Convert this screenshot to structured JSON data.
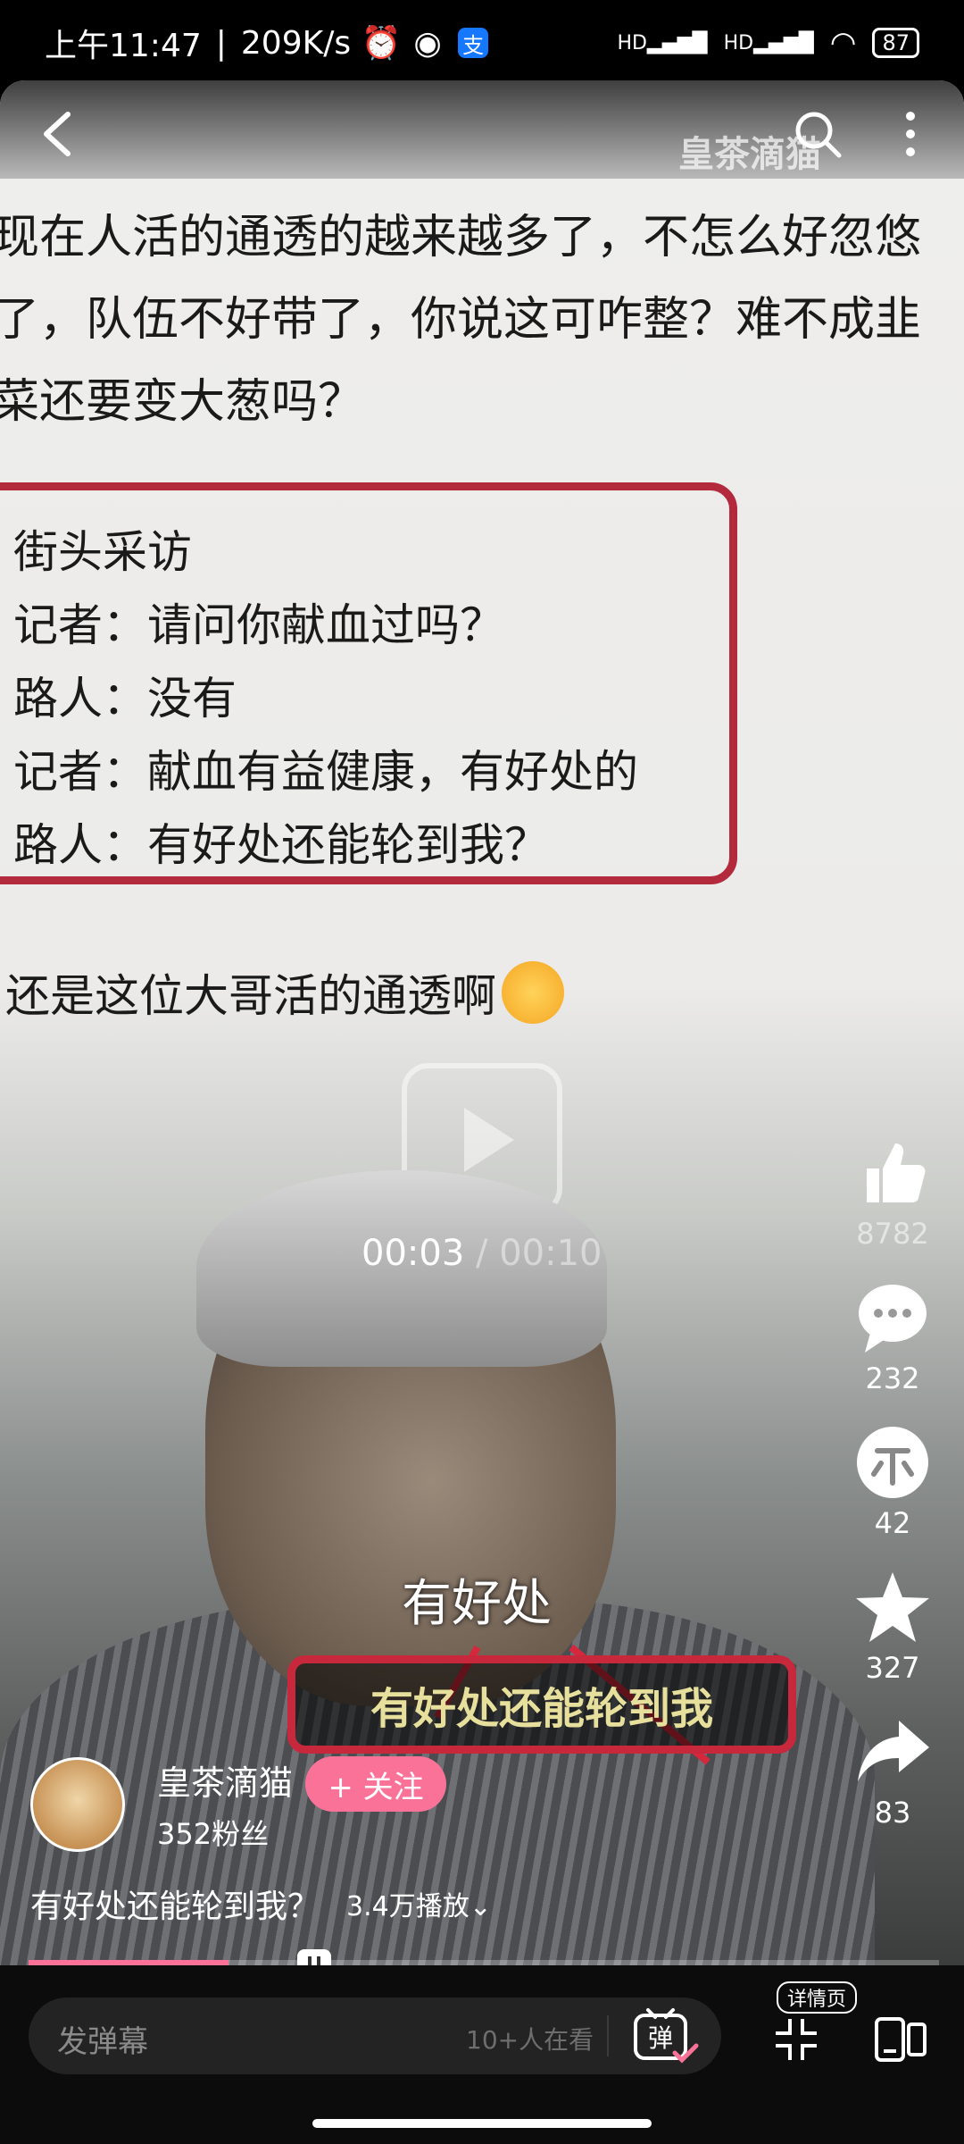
{
  "status_bar": {
    "time": "上午11:47",
    "network_speed": "209K/s",
    "signal_label_1": "HD",
    "signal_label_2": "HD",
    "battery": "87"
  },
  "video": {
    "watermark": "皇茶滴猫",
    "article": {
      "lines": [
        "现在人活的通透的越来越多了，不怎么好忽悠",
        "了，队伍不好带了，你说这可咋整？难不成韭",
        "菜还要变大葱吗？"
      ],
      "quote_lines": [
        "街头采访",
        "记者：请问你献血过吗？",
        "路人：没有",
        "记者：献血有益健康，有好处的",
        "路人：有好处还能轮到我？"
      ],
      "closing": "还是这位大哥活的通透啊"
    },
    "time_current": "00:03",
    "time_separator": "/",
    "time_total": "00:10",
    "caption_top": "有好处",
    "caption_boxed": "有好处还能轮到我",
    "progress_fraction": 0.22
  },
  "side_actions": {
    "likes": "8782",
    "comments": "232",
    "coins": "42",
    "favorites": "327",
    "shares": "83"
  },
  "author": {
    "name": "皇茶滴猫",
    "fans": "352粉丝",
    "follow_label": "+ 关注"
  },
  "video_meta": {
    "title": "有好处还能轮到我？",
    "views": "3.4万播放"
  },
  "bottom": {
    "danmaku_placeholder": "发弹幕",
    "watching": "10+人在看",
    "danmaku_button": "弹",
    "detail_label": "详情页"
  },
  "colors": {
    "accent": "#fb7299",
    "quote_border": "#b32a3d"
  }
}
